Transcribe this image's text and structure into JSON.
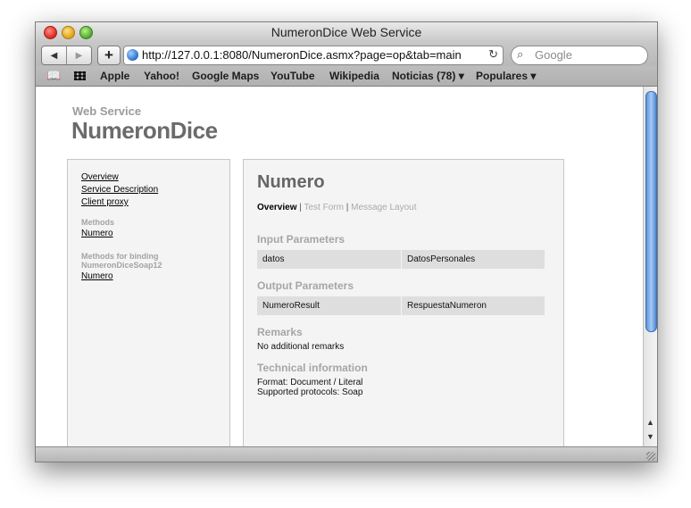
{
  "window": {
    "title": "NumeronDice Web Service"
  },
  "toolbar": {
    "url": "http://127.0.0.1:8080/NumeronDice.asmx?page=op&tab=main",
    "search_placeholder": "Google"
  },
  "bookmarks": [
    "Apple",
    "Yahoo!",
    "Google Maps",
    "YouTube",
    "Wikipedia",
    "Noticias (78) ▾",
    "Populares ▾"
  ],
  "page": {
    "service_label": "Web Service",
    "service_name": "NumeronDice"
  },
  "sidebar": {
    "links": [
      "Overview",
      "Service Description",
      "Client proxy"
    ],
    "methods_heading": "Methods",
    "methods": [
      "Numero"
    ],
    "binding_heading_line1": "Methods for binding",
    "binding_heading_line2": "NumeronDiceSoap12",
    "binding_methods": [
      "Numero"
    ]
  },
  "main": {
    "title": "Numero",
    "tabs": {
      "overview": "Overview",
      "sep": "|",
      "test_form": "Test Form",
      "message_layout": "Message Layout"
    },
    "input_heading": "Input Parameters",
    "input_params": [
      {
        "name": "datos",
        "type": "DatosPersonales"
      }
    ],
    "output_heading": "Output Parameters",
    "output_params": [
      {
        "name": "NumeroResult",
        "type": "RespuestaNumeron"
      }
    ],
    "remarks_heading": "Remarks",
    "remarks_text": "No additional remarks",
    "tech_heading": "Technical information",
    "tech_format": "Format: Document / Literal",
    "tech_protocols": "Supported protocols: Soap"
  }
}
